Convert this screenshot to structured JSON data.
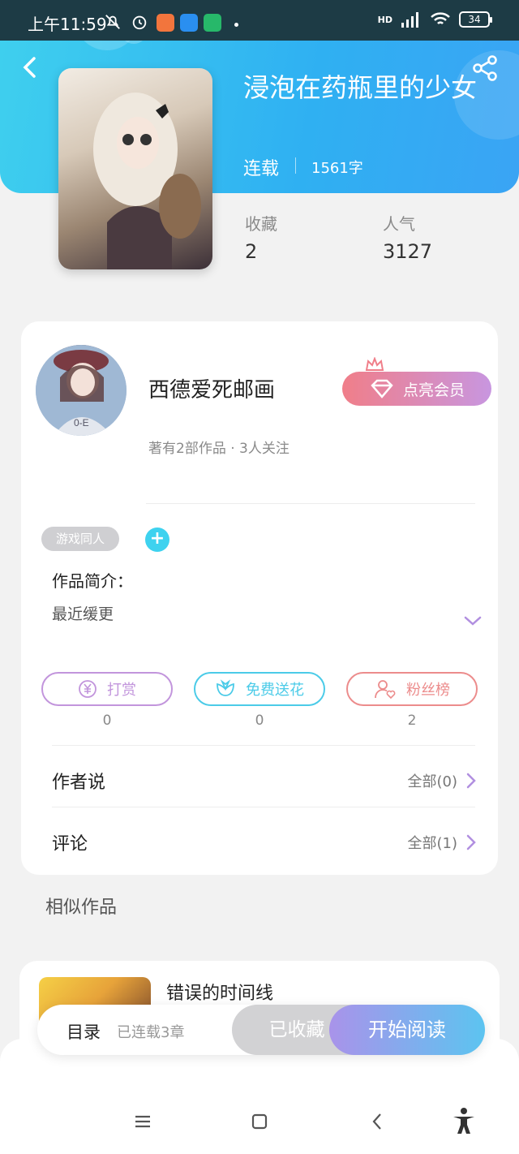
{
  "status_bar": {
    "time": "上午11:59",
    "network": "HD",
    "battery": "34",
    "icons": [
      "mute-icon",
      "alarm-icon",
      "app-icon",
      "cloud-icon",
      "shield-icon",
      "wifi-icon",
      "signal-icon",
      "battery-icon"
    ]
  },
  "work": {
    "title": "浸泡在药瓶里的少女",
    "status": "连载",
    "word_count": "1561字",
    "favorites_label": "收藏",
    "favorites_value": "2",
    "popularity_label": "人气",
    "popularity_value": "3127"
  },
  "author": {
    "name": "西德爱死邮画",
    "meta": "著有2部作品 · 3人关注",
    "vip_label": "点亮会员"
  },
  "tags": {
    "items": [
      "游戏同人"
    ],
    "add_label": "+"
  },
  "intro": {
    "label": "作品简介：",
    "text": "最近缓更"
  },
  "actions": [
    {
      "label": "打赏",
      "count": "0",
      "color": "#c295dc"
    },
    {
      "label": "免费送花",
      "count": "0",
      "color": "#4bcbe8"
    },
    {
      "label": "粉丝榜",
      "count": "2",
      "color": "#ec8c8c"
    }
  ],
  "rows": {
    "author_say_label": "作者说",
    "author_say_right": "全部(0)",
    "comments_label": "评论",
    "comments_right": "全部(1)"
  },
  "similar": {
    "title": "相似作品",
    "first_name": "错误的时间线"
  },
  "bottom": {
    "toc_label": "目录",
    "toc_count": "已连载3章",
    "collected_label": "已收藏",
    "read_label": "开始阅读"
  },
  "colors": {
    "header_gradient_start": "#3fd0ee",
    "header_gradient_end": "#3aa4f4",
    "vip_gradient_start": "#f07e89",
    "vip_gradient_end": "#c896e0",
    "read_gradient_start": "#a993ea",
    "read_gradient_end": "#5cc4f0",
    "accent_purple": "#b18fe0"
  }
}
